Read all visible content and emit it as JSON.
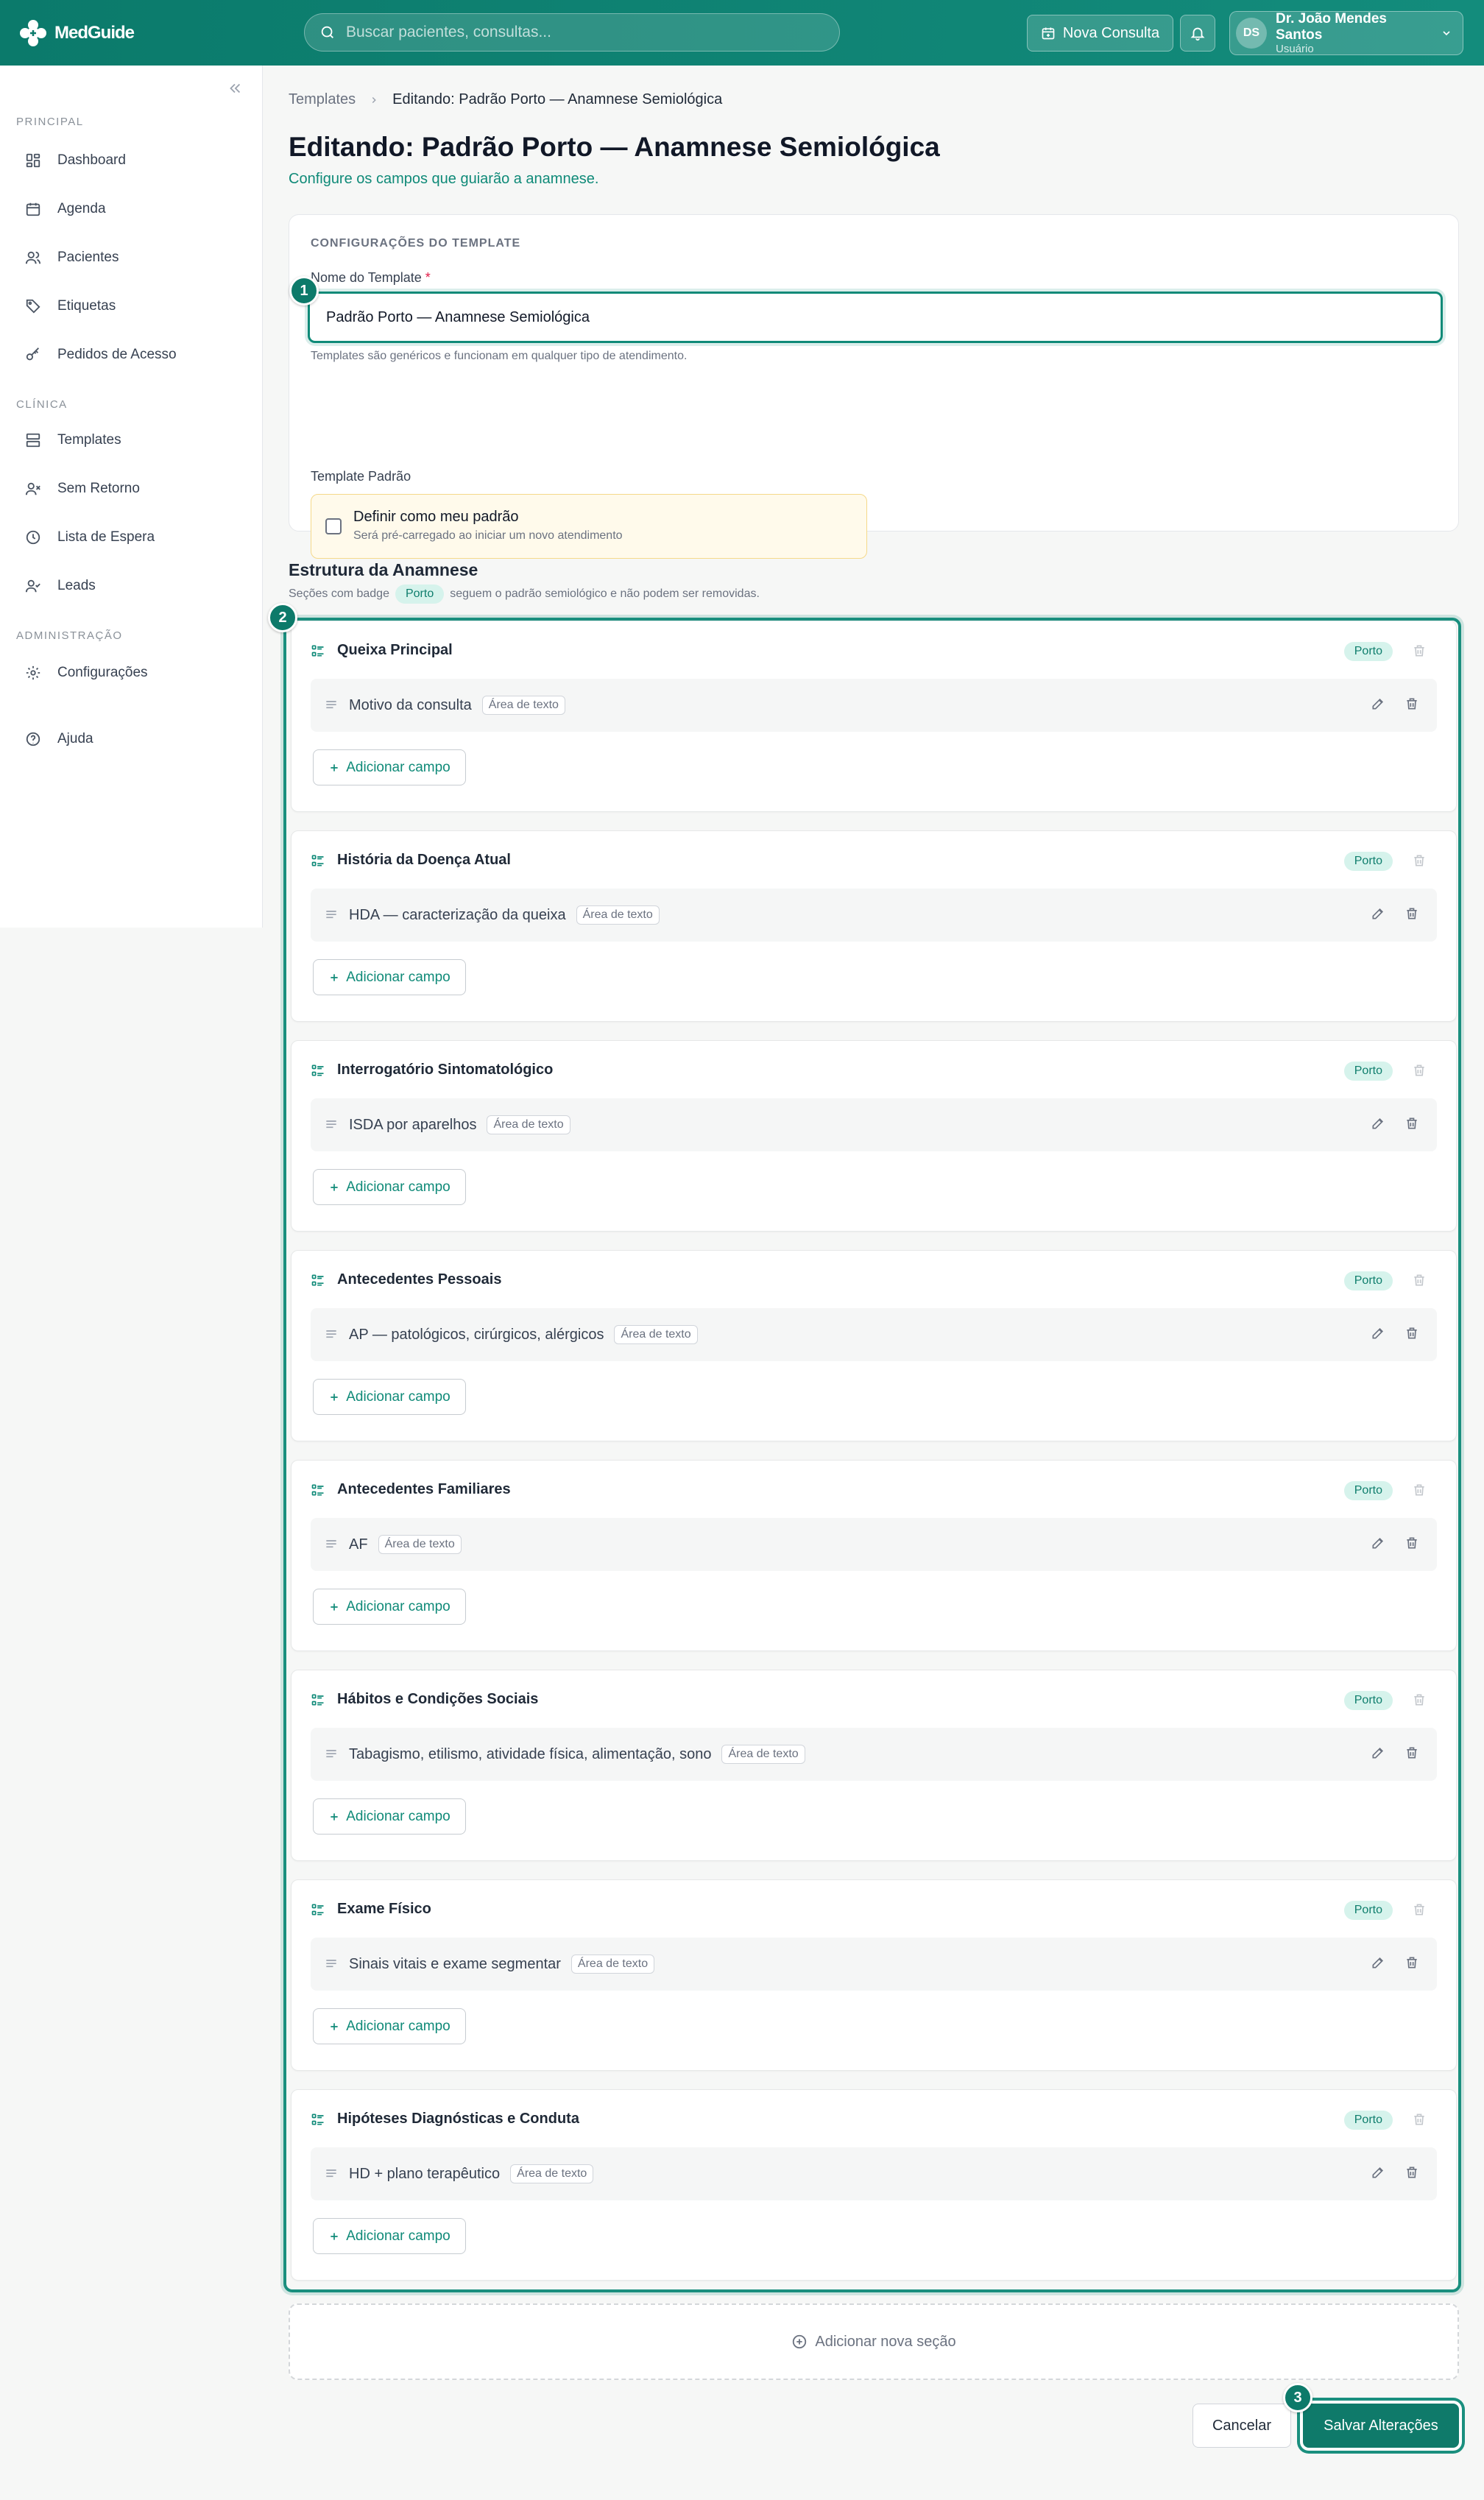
{
  "app": {
    "name": "MedGuide"
  },
  "header": {
    "search_placeholder": "Buscar pacientes, consultas...",
    "new_consult_label": "Nova Consulta",
    "user": {
      "initials": "DS",
      "name": "Dr. João Mendes Santos",
      "role": "Usuário"
    }
  },
  "sidebar": {
    "sections": [
      {
        "title": "PRINCIPAL",
        "items": [
          {
            "label": "Dashboard",
            "icon": "dashboard-icon"
          },
          {
            "label": "Agenda",
            "icon": "calendar-icon"
          },
          {
            "label": "Pacientes",
            "icon": "users-icon"
          },
          {
            "label": "Etiquetas",
            "icon": "tag-icon"
          },
          {
            "label": "Pedidos de Acesso",
            "icon": "key-icon"
          }
        ]
      },
      {
        "title": "CLÍNICA",
        "items": [
          {
            "label": "Templates",
            "icon": "template-icon"
          },
          {
            "label": "Sem Retorno",
            "icon": "user-x-icon"
          },
          {
            "label": "Lista de Espera",
            "icon": "clock-icon"
          },
          {
            "label": "Leads",
            "icon": "user-check-icon"
          }
        ]
      },
      {
        "title": "ADMINISTRAÇÃO",
        "items": [
          {
            "label": "Configurações",
            "icon": "gear-icon"
          }
        ]
      }
    ],
    "help_label": "Ajuda"
  },
  "breadcrumb": {
    "parent": "Templates",
    "current": "Editando: Padrão Porto — Anamnese Semiológica"
  },
  "page": {
    "title": "Editando: Padrão Porto — Anamnese Semiológica",
    "subtitle": "Configure os campos que guiarão a anamnese."
  },
  "settings": {
    "heading": "CONFIGURAÇÕES DO TEMPLATE",
    "name_label": "Nome do Template",
    "name_required": "*",
    "name_value": "Padrão Porto — Anamnese Semiológica",
    "name_hint": "Templates são genéricos e funcionam em qualquer tipo de atendimento.",
    "default_label": "Template Padrão",
    "default_checkbox_label": "Definir como meu padrão",
    "default_checkbox_desc": "Será pré-carregado ao iniciar um novo atendimento",
    "default_checked": false
  },
  "structure": {
    "title": "Estrutura da Anamnese",
    "subtitle_before": "Seções com badge",
    "subtitle_badge": "Porto",
    "subtitle_after": "seguem o padrão semiológico e não podem ser removidas.",
    "sections": [
      {
        "title": "Queixa Principal",
        "badge": "Porto",
        "fields": [
          {
            "name": "Motivo da consulta",
            "type": "Área de texto"
          }
        ]
      },
      {
        "title": "História da Doença Atual",
        "badge": "Porto",
        "fields": [
          {
            "name": "HDA — caracterização da queixa",
            "type": "Área de texto"
          }
        ]
      },
      {
        "title": "Interrogatório Sintomatológico",
        "badge": "Porto",
        "fields": [
          {
            "name": "ISDA por aparelhos",
            "type": "Área de texto"
          }
        ]
      },
      {
        "title": "Antecedentes Pessoais",
        "badge": "Porto",
        "fields": [
          {
            "name": "AP — patológicos, cirúrgicos, alérgicos",
            "type": "Área de texto"
          }
        ]
      },
      {
        "title": "Antecedentes Familiares",
        "badge": "Porto",
        "fields": [
          {
            "name": "AF",
            "type": "Área de texto"
          }
        ]
      },
      {
        "title": "Hábitos e Condições Sociais",
        "badge": "Porto",
        "fields": [
          {
            "name": "Tabagismo, etilismo, atividade física, alimentação, sono",
            "type": "Área de texto"
          }
        ]
      },
      {
        "title": "Exame Físico",
        "badge": "Porto",
        "fields": [
          {
            "name": "Sinais vitais e exame segmentar",
            "type": "Área de texto"
          }
        ]
      },
      {
        "title": "Hipóteses Diagnósticas e Conduta",
        "badge": "Porto",
        "fields": [
          {
            "name": "HD + plano terapêutico",
            "type": "Área de texto"
          }
        ]
      }
    ],
    "add_field_label": "Adicionar campo",
    "add_section_label": "Adicionar nova seção"
  },
  "actions": {
    "cancel_label": "Cancelar",
    "save_label": "Salvar Alterações"
  },
  "steps": [
    "1",
    "2",
    "3"
  ],
  "colors": {
    "brand": "#0f8a78",
    "badge_bg": "#d6f3ec",
    "warning_bg": "#fffaeb"
  }
}
